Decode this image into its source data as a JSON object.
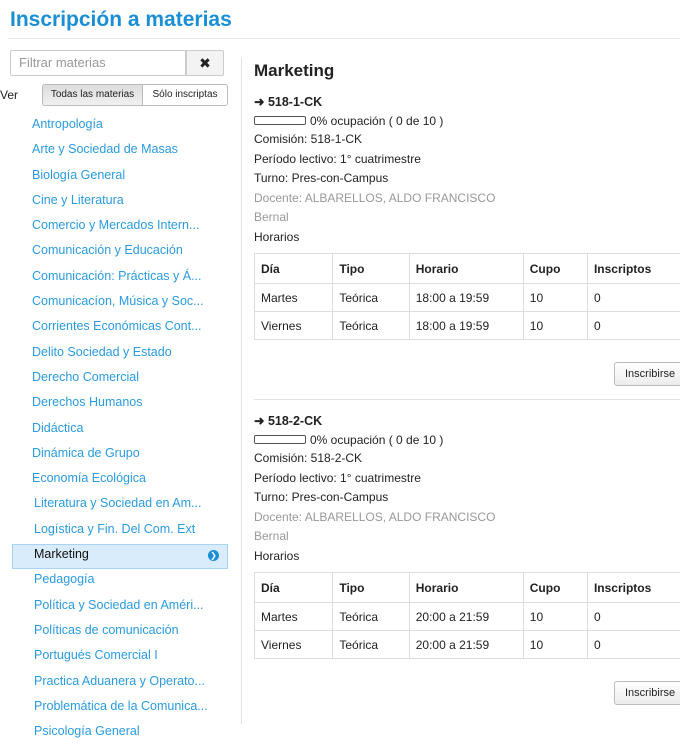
{
  "page": {
    "title": "Inscripción a materias"
  },
  "filter": {
    "placeholder": "Filtrar materias",
    "clear_symbol": "✖"
  },
  "view": {
    "label": "Ver",
    "all_label": "Todas las materias",
    "mine_label": "Sólo inscriptas"
  },
  "materias": [
    "Antropología",
    "Arte y Sociedad de Masas",
    "Biología General",
    "Cine y Literatura",
    "Comercio y Mercados Intern...",
    "Comunicación y Educación",
    "Comunicación: Prácticas y Á...",
    "Comunicacíon, Música y Soc...",
    "Corrientes Económicas Cont...",
    "Delito Sociedad y Estado",
    "Derecho Comercial",
    "Derechos Humanos",
    "Didáctica",
    "Dinámica de Grupo",
    "Economía Ecológica",
    "Literatura y Sociedad en Am...",
    "Logística y Fin. Del Com. Ext",
    "Marketing",
    "Pedagogía",
    "Política y Sociedad en Améri...",
    "Políticas de comunicación",
    "Portugués Comercial I",
    "Practica Aduanera y Operato...",
    "Problemática de la Comunica...",
    "Psicología General"
  ],
  "selected_materia": "Marketing",
  "main": {
    "subject": "Marketing",
    "headers": [
      "Día",
      "Tipo",
      "Horario",
      "Cupo",
      "Inscriptos"
    ],
    "horarios_label": "Horarios",
    "enroll_label": "Inscribirse",
    "commissions": [
      {
        "code": "➜ 518-1-CK",
        "occupancy_text": "0% ocupación ( 0 de 10 )",
        "occupancy_fraction": 0,
        "comision": "Comisión: 518-1-CK",
        "periodo": "Período lectivo: 1° cuatrimestre",
        "turno": "Turno: Pres-con-Campus",
        "docente": "Docente: ALBARELLOS, ALDO FRANCISCO",
        "sede": "Bernal",
        "rows": [
          [
            "Martes",
            "Teórica",
            "18:00 a 19:59",
            "10",
            "0"
          ],
          [
            "Viernes",
            "Teórica",
            "18:00 a 19:59",
            "10",
            "0"
          ]
        ]
      },
      {
        "code": "➜ 518-2-CK",
        "occupancy_text": "0% ocupación ( 0 de 10 )",
        "occupancy_fraction": 0,
        "comision": "Comisión: 518-2-CK",
        "periodo": "Período lectivo: 1° cuatrimestre",
        "turno": "Turno: Pres-con-Campus",
        "docente": "Docente: ALBARELLOS, ALDO FRANCISCO",
        "sede": "Bernal",
        "rows": [
          [
            "Martes",
            "Teórica",
            "20:00 a 21:59",
            "10",
            "0"
          ],
          [
            "Viernes",
            "Teórica",
            "20:00 a 21:59",
            "10",
            "0"
          ]
        ]
      }
    ]
  }
}
